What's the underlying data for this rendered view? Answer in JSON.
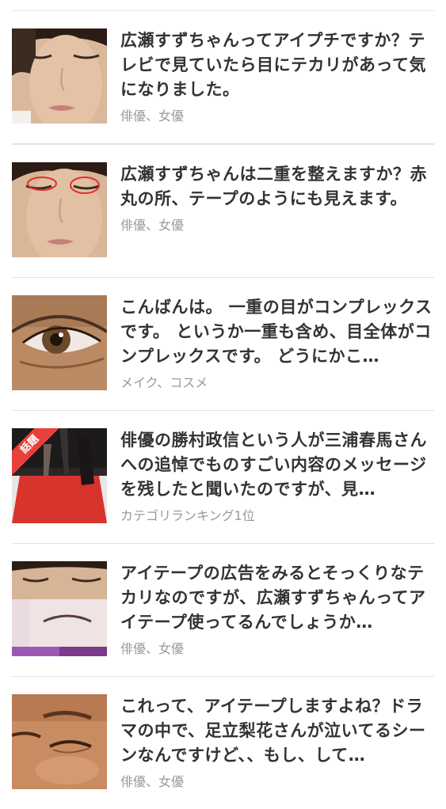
{
  "items": [
    {
      "title": "広瀬すずちゃんってアイプチですか？テレビで見ていたら目にテカリがあって気になりました。",
      "category": "俳優、女優",
      "thumbnail_icon": "face-closed-eyes-photo"
    },
    {
      "title": "広瀬すずちゃんは二重を整えますか？赤丸の所、テープのようにも見えます。",
      "category": "俳優、女優",
      "thumbnail_icon": "face-circled-eyes-photo"
    },
    {
      "title": "こんばんは。 一重の目がコンプレックスです。 というか一重も含め、目全体がコンプレックスです。 どうにかこ…",
      "category": "メイク、コスメ",
      "thumbnail_icon": "eye-closeup-photo"
    },
    {
      "title": "俳優の勝村政信という人が三浦春馬さんへの追悼でものすごい内容のメッセージを残したと聞いたのですが、見…",
      "category": "カテゴリランキング1位",
      "thumbnail_icon": "red-carpet-photo",
      "badge": "話題"
    },
    {
      "title": "アイテープの広告をみるとそっくりなテカリなのですが、広瀬すずちゃんってアイテープ使ってるんでしょうか…",
      "category": "俳優、女優",
      "thumbnail_icon": "eye-tape-ad-photo"
    },
    {
      "title": "これって、アイテープしますよね？ドラマの中で、足立梨花さんが泣いてるシーンなんですけど、、もし、して…",
      "category": "俳優、女優",
      "thumbnail_icon": "crying-face-photo"
    }
  ],
  "colors": {
    "title": "#333333",
    "category": "#999999",
    "divider": "#e2e2e2",
    "badge": "#e8413b"
  }
}
